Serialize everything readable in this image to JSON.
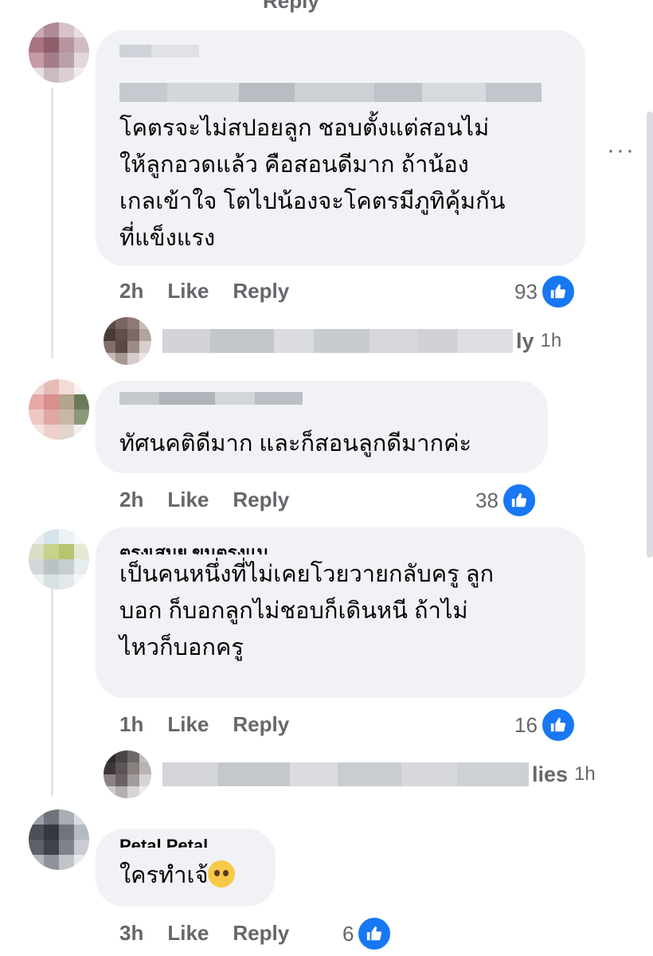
{
  "top_fragment": "Reply",
  "more_label": "···",
  "comments": [
    {
      "text": "โคตรจะไม่สปอยลูก ชอบตั้งแต่สอนไม่\nให้ลูกอวดแล้ว คือสอนดีมาก ถ้าน้อง\nเกลเข้าใจ โตไปน้องจะโคตรมีภูทิคุ้มกัน\nที่แข็งแรง",
      "time": "2h",
      "like": "Like",
      "reply": "Reply",
      "reactions": "93",
      "replies_tail": "ly",
      "replies_time": "1h"
    },
    {
      "text": "ทัศนคติดีมาก และก็สอนลูกดีมากค่ะ",
      "time": "2h",
      "like": "Like",
      "reply": "Reply",
      "reactions": "38"
    },
    {
      "name_fragment": "ตรงเสมย ขนตรงแม",
      "text": "เป็นคนหนึ่งที่ไม่เคยโวยวายกลับครู ลูก\nบอก ก็บอกลูกไม่ชอบก็เดินหนี ถ้าไม่\nไหวก็บอกครู",
      "time": "1h",
      "like": "Like",
      "reply": "Reply",
      "reactions": "16",
      "replies_tail": "lies",
      "replies_time": "1h"
    },
    {
      "name_fragment": "Petal Petal",
      "text": "ใครทำเจ้",
      "emoji": "pleading-face-emoji",
      "time": "3h",
      "like": "Like",
      "reply": "Reply",
      "reactions": "6"
    }
  ],
  "colors": {
    "bubble": "#f0f2f5",
    "like_blue": "#1877f2",
    "meta_gray": "#65676b"
  }
}
